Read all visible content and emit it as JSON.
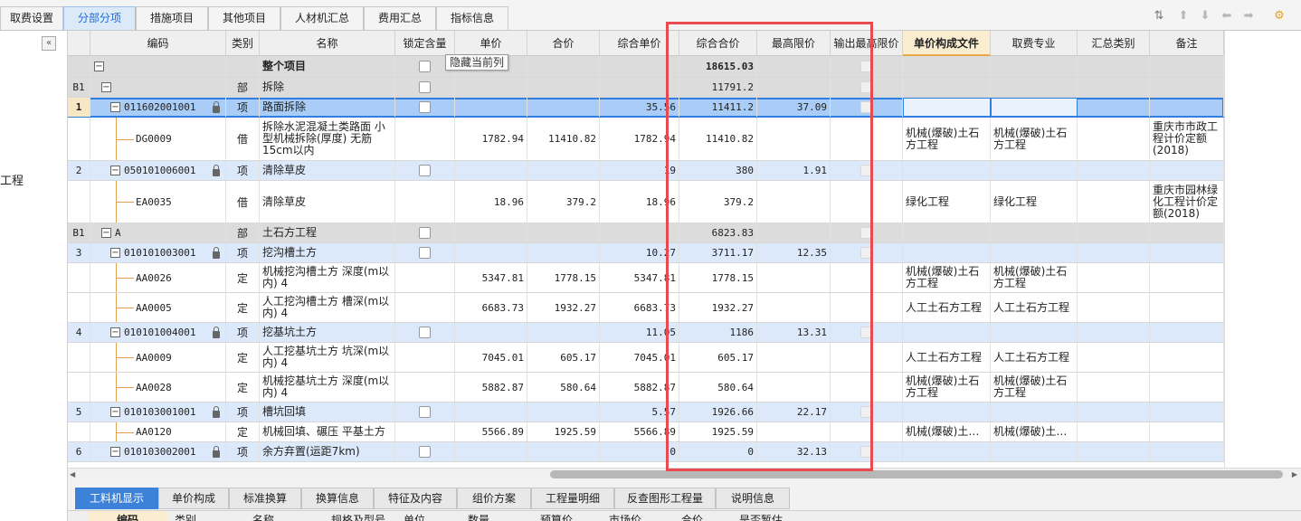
{
  "top_tabs": [
    "取费设置",
    "分部分项",
    "措施项目",
    "其他项目",
    "人材机汇总",
    "费用汇总",
    "指标信息"
  ],
  "left_label": "工程",
  "collapse_glyph": "«",
  "columns": [
    "编码",
    "类别",
    "名称",
    "锁定含量",
    "单价",
    "合价",
    "综合单价",
    "综合合价",
    "最高限价",
    "输出最高限价",
    "单价构成文件",
    "取费专业",
    "汇总类别",
    "备注"
  ],
  "tooltip": "隐藏当前列",
  "rows": [
    {
      "seq": "",
      "code": "",
      "type": "",
      "name": "整个项目",
      "price": "",
      "total": "",
      "cprice": "",
      "ctotal": "18615.03",
      "limit": "",
      "file": "",
      "spec": "",
      "note": ""
    },
    {
      "seq": "B1",
      "code": "",
      "type": "部",
      "name": "拆除",
      "price": "",
      "total": "",
      "cprice": "",
      "ctotal": "11791.2",
      "limit": "",
      "file": "",
      "spec": "",
      "note": ""
    },
    {
      "seq": "1",
      "code": "011602001001",
      "type": "项",
      "name": "路面拆除",
      "price": "",
      "total": "",
      "cprice": "35.56",
      "ctotal": "11411.2",
      "limit": "37.09",
      "file": "",
      "spec": "",
      "note": ""
    },
    {
      "seq": "",
      "code": "DG0009",
      "type": "借",
      "name": "拆除水泥混凝土类路面 小型机械拆除(厚度) 无筋15cm以内",
      "price": "1782.94",
      "total": "11410.82",
      "cprice": "1782.94",
      "ctotal": "11410.82",
      "limit": "",
      "file": "机械(爆破)土石方工程",
      "spec": "机械(爆破)土石方工程",
      "note": "重庆市市政工程计价定额(2018)"
    },
    {
      "seq": "2",
      "code": "050101006001",
      "type": "项",
      "name": "清除草皮",
      "price": "",
      "total": "",
      "cprice": "19",
      "ctotal": "380",
      "limit": "1.91",
      "file": "",
      "spec": "",
      "note": ""
    },
    {
      "seq": "",
      "code": "EA0035",
      "type": "借",
      "name": "清除草皮",
      "price": "18.96",
      "total": "379.2",
      "cprice": "18.96",
      "ctotal": "379.2",
      "limit": "",
      "file": "绿化工程",
      "spec": "绿化工程",
      "note": "重庆市园林绿化工程计价定额(2018)"
    },
    {
      "seq": "B1",
      "code": "A",
      "type": "部",
      "name": "土石方工程",
      "price": "",
      "total": "",
      "cprice": "",
      "ctotal": "6823.83",
      "limit": "",
      "file": "",
      "spec": "",
      "note": ""
    },
    {
      "seq": "3",
      "code": "010101003001",
      "type": "项",
      "name": "挖沟槽土方",
      "price": "",
      "total": "",
      "cprice": "10.27",
      "ctotal": "3711.17",
      "limit": "12.35",
      "file": "",
      "spec": "",
      "note": ""
    },
    {
      "seq": "",
      "code": "AA0026",
      "type": "定",
      "name": "机械挖沟槽土方 深度(m以内) 4",
      "price": "5347.81",
      "total": "1778.15",
      "cprice": "5347.81",
      "ctotal": "1778.15",
      "limit": "",
      "file": "机械(爆破)土石方工程",
      "spec": "机械(爆破)土石方工程",
      "note": ""
    },
    {
      "seq": "",
      "code": "AA0005",
      "type": "定",
      "name": "人工挖沟槽土方 槽深(m以内) 4",
      "price": "6683.73",
      "total": "1932.27",
      "cprice": "6683.73",
      "ctotal": "1932.27",
      "limit": "",
      "file": "人工土石方工程",
      "spec": "人工土石方工程",
      "note": ""
    },
    {
      "seq": "4",
      "code": "010101004001",
      "type": "项",
      "name": "挖基坑土方",
      "price": "",
      "total": "",
      "cprice": "11.05",
      "ctotal": "1186",
      "limit": "13.31",
      "file": "",
      "spec": "",
      "note": ""
    },
    {
      "seq": "",
      "code": "AA0009",
      "type": "定",
      "name": "人工挖基坑土方 坑深(m以内) 4",
      "price": "7045.01",
      "total": "605.17",
      "cprice": "7045.01",
      "ctotal": "605.17",
      "limit": "",
      "file": "人工土石方工程",
      "spec": "人工土石方工程",
      "note": ""
    },
    {
      "seq": "",
      "code": "AA0028",
      "type": "定",
      "name": "机械挖基坑土方 深度(m以内) 4",
      "price": "5882.87",
      "total": "580.64",
      "cprice": "5882.87",
      "ctotal": "580.64",
      "limit": "",
      "file": "机械(爆破)土石方工程",
      "spec": "机械(爆破)土石方工程",
      "note": ""
    },
    {
      "seq": "5",
      "code": "010103001001",
      "type": "项",
      "name": "槽坑回填",
      "price": "",
      "total": "",
      "cprice": "5.57",
      "ctotal": "1926.66",
      "limit": "22.17",
      "file": "",
      "spec": "",
      "note": ""
    },
    {
      "seq": "",
      "code": "AA0120",
      "type": "定",
      "name": "机械回填、碾压 平基土方",
      "price": "5566.89",
      "total": "1925.59",
      "cprice": "5566.89",
      "ctotal": "1925.59",
      "limit": "",
      "file": "机械(爆破)土…",
      "spec": "机械(爆破)土…",
      "note": ""
    },
    {
      "seq": "6",
      "code": "010103002001",
      "type": "项",
      "name": "余方弃置(运距7km)",
      "price": "",
      "total": "",
      "cprice": "0",
      "ctotal": "0",
      "limit": "32.13",
      "file": "",
      "spec": "",
      "note": ""
    }
  ],
  "bottom_tabs": [
    "工料机显示",
    "单价构成",
    "标准换算",
    "换算信息",
    "特征及内容",
    "组价方案",
    "工程量明细",
    "反查图形工程量",
    "说明信息"
  ],
  "bottom_columns": [
    "编码",
    "类别",
    "名称",
    "规格及型号",
    "单位",
    "数量",
    "预算价",
    "市场价",
    "合价",
    "是否暂估"
  ],
  "colors": {
    "highlight_row": "#dce9fa",
    "selected_border": "#2f7fe0",
    "red_box": "#e84a4f",
    "tab_active": "#dbe9f9",
    "bottom_tab_active": "#3b82d8"
  }
}
